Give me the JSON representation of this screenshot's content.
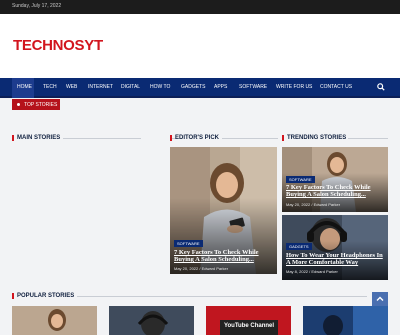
{
  "topbar": {
    "date": "Sunday, July 17, 2022"
  },
  "brand": {
    "logo": "TECHNOSYT",
    "logo_color": "#d2151e"
  },
  "nav": {
    "items": [
      "HOME",
      "TECH",
      "WEB",
      "INTERNET",
      "DIGITAL",
      "HOW TO",
      "GADGETS",
      "APPS",
      "SOFTWARE",
      "WRITE FOR US",
      "CONTACT US"
    ],
    "search_icon": "search-icon",
    "bg_color": "#0a2a73"
  },
  "top_stories": {
    "label": "TOP STORIES"
  },
  "sections": {
    "main": "MAIN STORIES",
    "editors": "EDITOR'S PICK",
    "trending": "TRENDING STORIES",
    "popular": "POPULAR STORIES"
  },
  "editors_pick": {
    "category": "SOFTWARE",
    "title": "7 Key Factors To Check While Buying A Salon Scheduling...",
    "date": "May 20, 2022",
    "author": "Edward Parker"
  },
  "trending": [
    {
      "category": "SOFTWARE",
      "title": "7 Key Factors To Check While Buying A Salon Scheduling...",
      "date": "May 20, 2022",
      "author": "Edward Parker"
    },
    {
      "category": "GADGETS",
      "title": "How To Wear Your Headphones In A More Comfortable Way",
      "date": "May 8, 2022",
      "author": "Edward Parker"
    }
  ],
  "popular_thumb_text": "YouTube Channel",
  "scroll_top_icon": "chevron-up-icon"
}
